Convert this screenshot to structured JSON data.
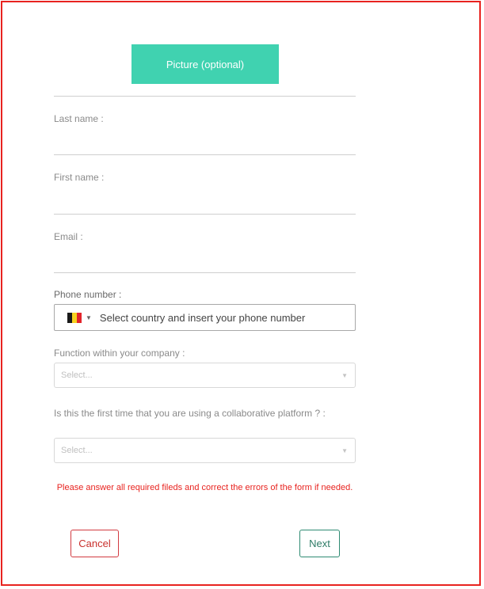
{
  "colors": {
    "accent": "#40d2b0",
    "error": "#e8231f",
    "cancel": "#c9302c",
    "next": "#2e7b66",
    "frame_border": "#e8231f"
  },
  "picture_button": {
    "label": "Picture (optional)"
  },
  "fields": {
    "last_name": {
      "label": "Last name :",
      "value": ""
    },
    "first_name": {
      "label": "First name :",
      "value": ""
    },
    "email": {
      "label": "Email :",
      "value": ""
    }
  },
  "phone": {
    "label": "Phone number :",
    "country_flag": "belgium-flag-icon",
    "placeholder": "Select country and insert your phone number",
    "value": ""
  },
  "function_select": {
    "label": "Function within your company :",
    "value": "Select..."
  },
  "platform_select": {
    "label": "Is this the first time that you are using a collaborative platform ? :",
    "value": "Select..."
  },
  "error_message": "Please answer all required fileds and correct the errors of the form if needed.",
  "buttons": {
    "cancel": "Cancel",
    "next": "Next"
  }
}
